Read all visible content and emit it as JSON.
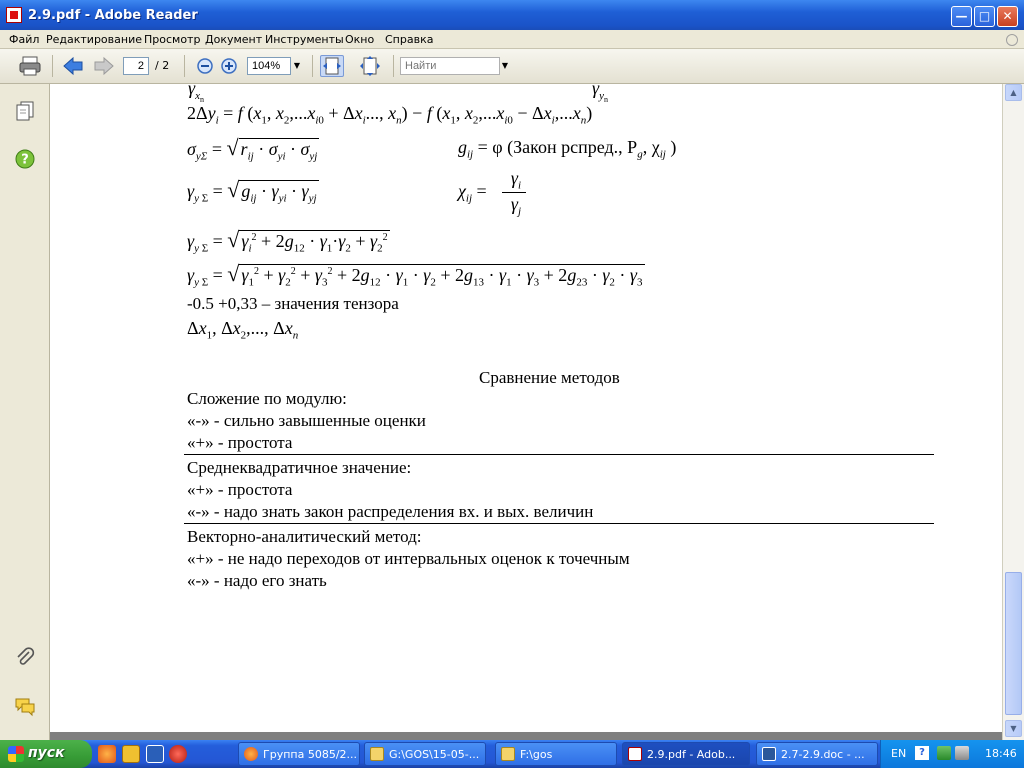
{
  "window": {
    "title": "2.9.pdf - Adobe Reader"
  },
  "menu": [
    "Файл",
    "Редактирование",
    "Просмотр",
    "Документ",
    "Инструменты",
    "Окно",
    "Справка"
  ],
  "toolbar": {
    "page_current": "2",
    "page_total": "/ 2",
    "zoom": "104%",
    "find_placeholder": "Найти"
  },
  "doc": {
    "formulas": {
      "sigma_sum": "σ",
      "sigma_sub": "yΣ",
      "sigma_rhs": "r",
      "g_ij": "g",
      "g_rhs": "= φ (Закон рспред., P",
      "g_rhs2": ", χ",
      "g_rhs3": ")",
      "gamma1_lhs": "γ",
      "chi_lhs": "χ"
    },
    "tensor_line": "-0.5  +0,33 – значения тензора",
    "section_title": "Сравнение методов",
    "methods": [
      {
        "heading": "Сложение по модулю:",
        "lines": [
          "«-» - сильно завышенные оценки",
          "«+» - простота"
        ]
      },
      {
        "heading": "Среднеквадратичное значение:",
        "lines": [
          "«+» - простота",
          "«-» - надо знать закон распределения вх. и вых. величин"
        ]
      },
      {
        "heading": "Векторно-аналитический метод:",
        "lines": [
          "«+» - не надо переходов от интервальных оценок к точечным",
          "«-» - надо его знать"
        ]
      }
    ]
  },
  "taskbar": {
    "start_label": "пуск",
    "tasks": [
      "Группа 5085/2...",
      "G:\\GOS\\15-05-...",
      "F:\\gos",
      "2.9.pdf - Adob...",
      "2.7-2.9.doc - ..."
    ],
    "lang": "EN",
    "time": "18:46"
  },
  "colors": {
    "titlebar": "#1f5fd6",
    "taskbar": "#245edb",
    "start": "#379c36"
  }
}
